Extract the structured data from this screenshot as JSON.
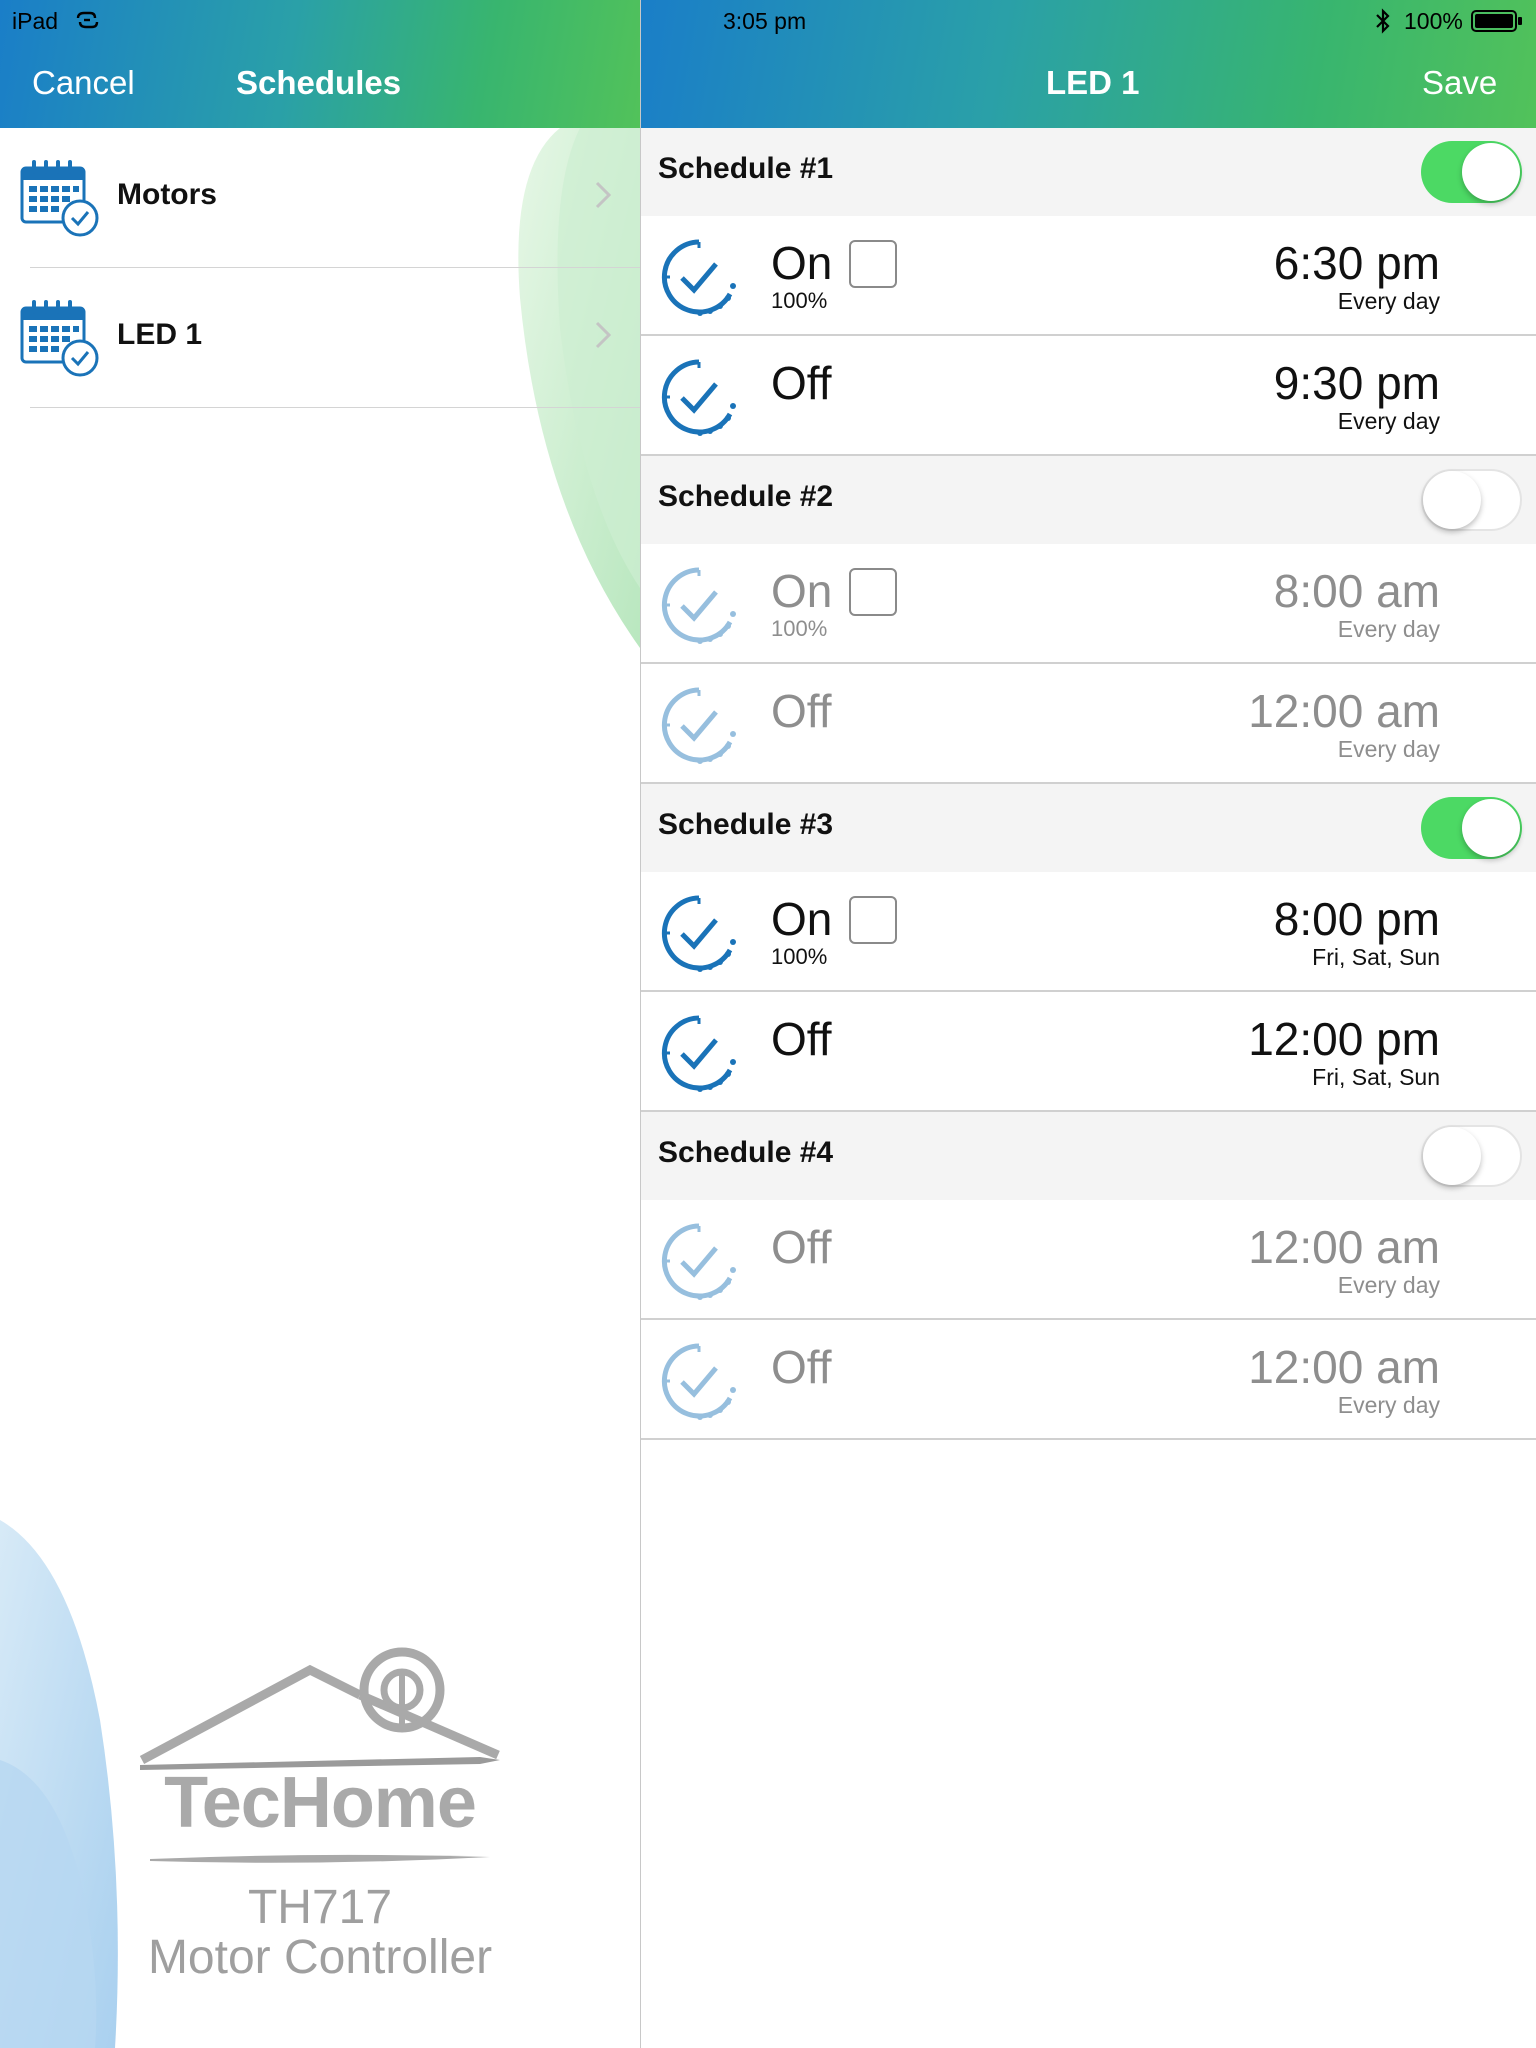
{
  "status_bar": {
    "device": "iPad",
    "time": "3:05 pm",
    "battery": "100%"
  },
  "master": {
    "cancel_label": "Cancel",
    "title": "Schedules",
    "items": [
      {
        "label": "Motors",
        "icon": "calendar-clock-icon"
      },
      {
        "label": "LED 1",
        "icon": "calendar-clock-icon"
      }
    ]
  },
  "detail": {
    "title": "LED 1",
    "save_label": "Save",
    "schedules": [
      {
        "title": "Schedule #1",
        "enabled": true,
        "events": [
          {
            "state": "On",
            "percent": "100%",
            "checkbox": true,
            "time": "6:30 pm",
            "days": "Every day"
          },
          {
            "state": "Off",
            "percent": "",
            "checkbox": false,
            "time": "9:30 pm",
            "days": "Every day"
          }
        ]
      },
      {
        "title": "Schedule #2",
        "enabled": false,
        "events": [
          {
            "state": "On",
            "percent": "100%",
            "checkbox": true,
            "time": "8:00 am",
            "days": "Every day"
          },
          {
            "state": "Off",
            "percent": "",
            "checkbox": false,
            "time": "12:00 am",
            "days": "Every day"
          }
        ]
      },
      {
        "title": "Schedule #3",
        "enabled": true,
        "events": [
          {
            "state": "On",
            "percent": "100%",
            "checkbox": true,
            "time": "8:00 pm",
            "days": "Fri, Sat, Sun"
          },
          {
            "state": "Off",
            "percent": "",
            "checkbox": false,
            "time": "12:00 pm",
            "days": "Fri, Sat, Sun"
          }
        ]
      },
      {
        "title": "Schedule #4",
        "enabled": false,
        "events": [
          {
            "state": "Off",
            "percent": "",
            "checkbox": false,
            "time": "12:00 am",
            "days": "Every day"
          },
          {
            "state": "Off",
            "percent": "",
            "checkbox": false,
            "time": "12:00 am",
            "days": "Every day"
          }
        ]
      }
    ]
  },
  "brand": {
    "name": "TecHome",
    "model": "TH717",
    "description": "Motor Controller"
  },
  "colors": {
    "toggle_on": "#4cd964",
    "accent_blue": "#1a73b8",
    "header_gradient_start": "#1a7ec8",
    "header_gradient_end": "#52c25a"
  }
}
